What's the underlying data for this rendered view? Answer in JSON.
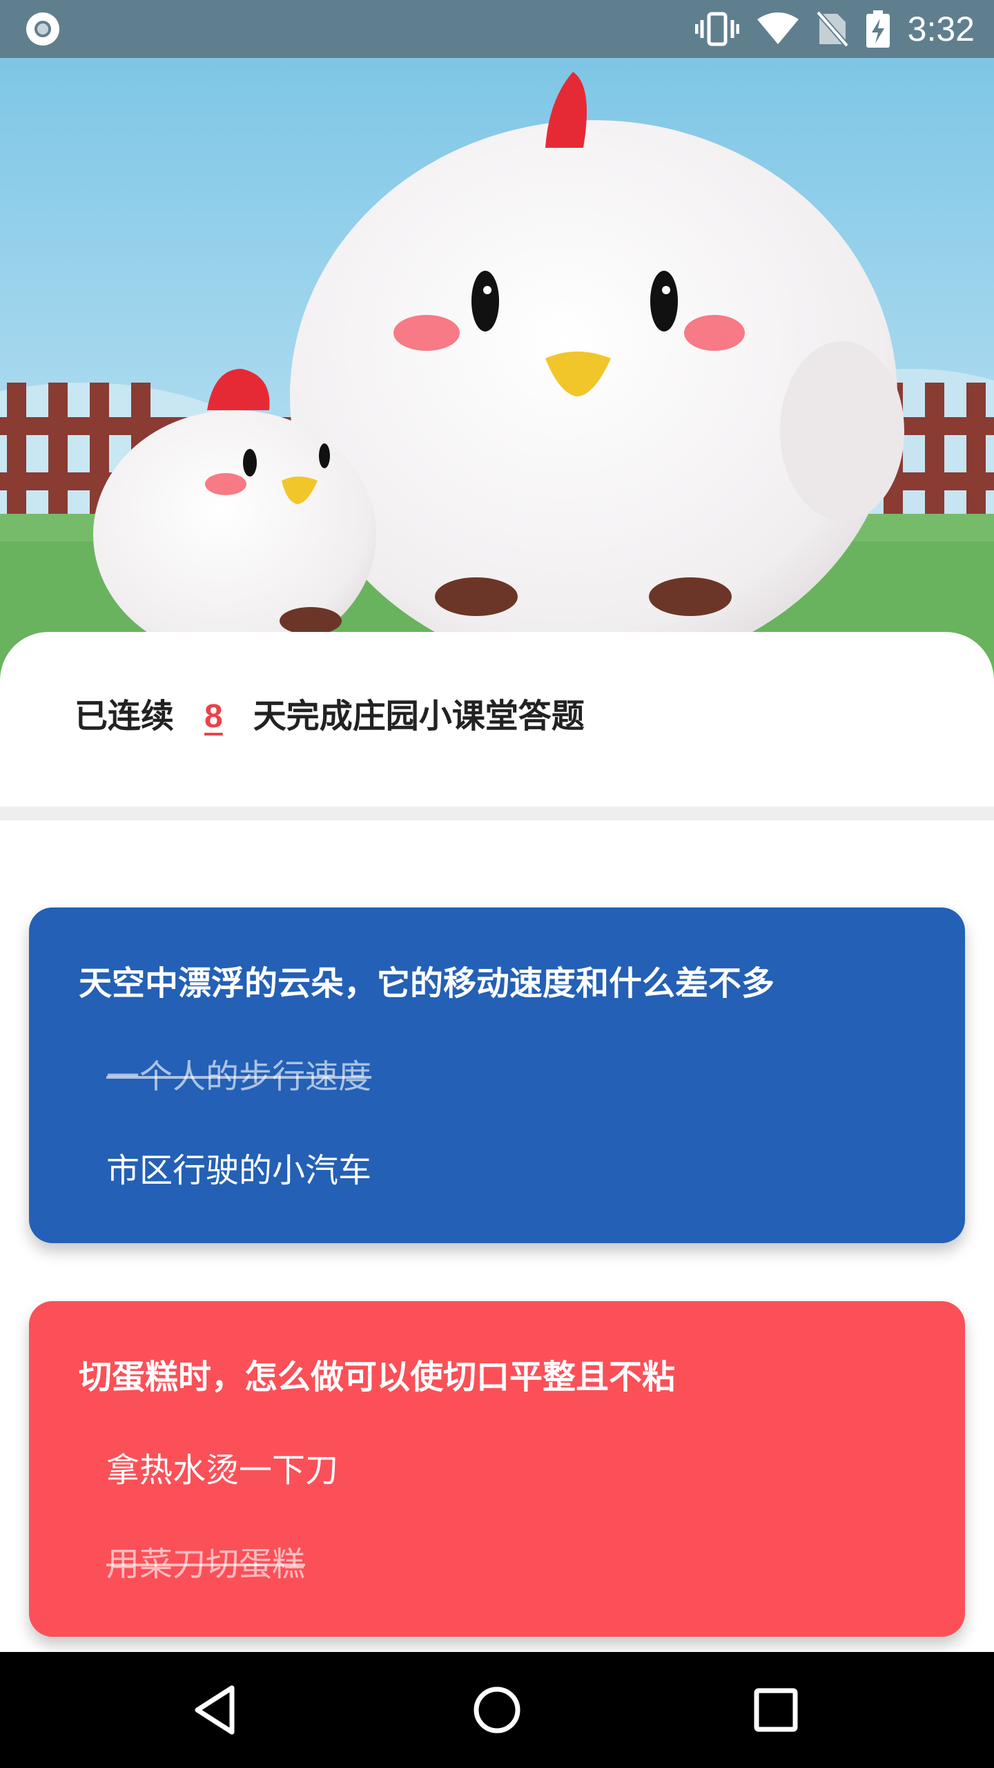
{
  "status_bar": {
    "time": "3:32",
    "icons": [
      "record-indicator-icon",
      "vibrate-icon",
      "wifi-icon",
      "no-sim-icon",
      "battery-charging-icon"
    ]
  },
  "hero": {
    "image": "plush white chickens in front of a fence and blue sky"
  },
  "streak": {
    "prefix": "已连续",
    "count": "8",
    "suffix": "天完成庄园小课堂答题"
  },
  "questions": [
    {
      "title": "天空中漂浮的云朵，它的移动速度和什么差不多",
      "color": "#2460b5",
      "options": [
        {
          "label": "一个人的步行速度",
          "struck": true
        },
        {
          "label": "市区行驶的小汽车",
          "struck": false
        }
      ]
    },
    {
      "title": "切蛋糕时，怎么做可以使切口平整且不粘",
      "color": "#fb5058",
      "options": [
        {
          "label": "拿热水烫一下刀",
          "struck": false
        },
        {
          "label": "用菜刀切蛋糕",
          "struck": true
        }
      ]
    }
  ],
  "nav_bar": {
    "buttons": [
      "back-icon",
      "home-icon",
      "recents-icon"
    ]
  }
}
